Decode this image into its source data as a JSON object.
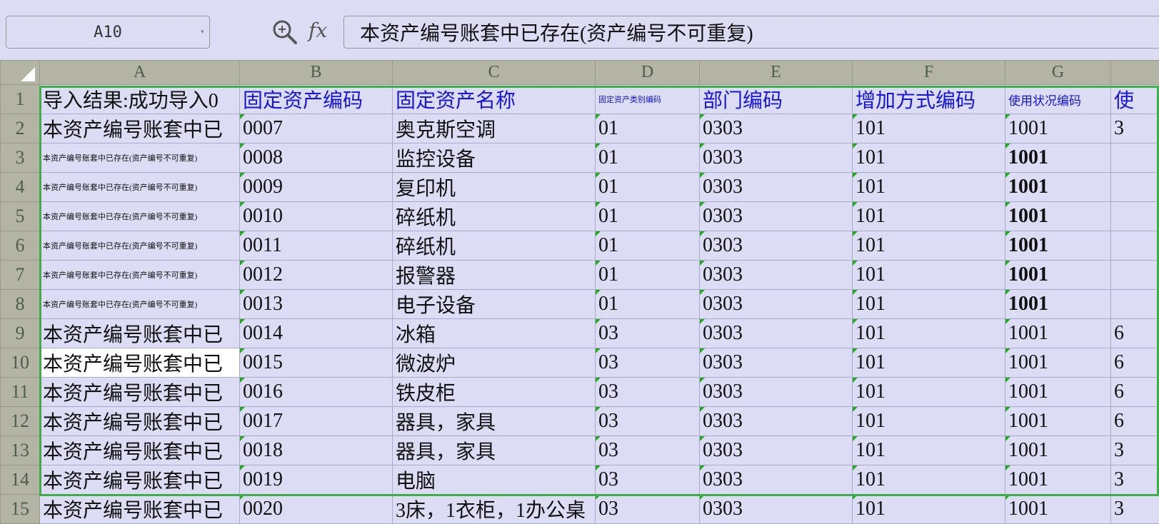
{
  "formula_bar": {
    "cell_ref": "A10",
    "fx_label": "fx",
    "formula": "本资产编号账套中已存在(资产编号不可重复)"
  },
  "columns": [
    "A",
    "B",
    "C",
    "D",
    "E",
    "F",
    "G"
  ],
  "header_row": {
    "row_num": "1",
    "a": "导入结果:成功导入0",
    "b": "固定资产编码",
    "c": "固定资产名称",
    "d": "固定资产类别编码",
    "e": "部门编码",
    "f": "增加方式编码",
    "g": "使用状况编码",
    "h": "使"
  },
  "rows": [
    {
      "n": "2",
      "a": "本资产编号账套中已",
      "b": "0007",
      "c": "奥克斯空调",
      "d": "01",
      "e": "0303",
      "f": "101",
      "g": "1001",
      "h": "3"
    },
    {
      "n": "3",
      "a": "本资产编号账套中已存在(资产编号不可重复)",
      "b": "0008",
      "c": "监控设备",
      "d": "01",
      "e": "0303",
      "f": "101",
      "g": "1001",
      "h": ""
    },
    {
      "n": "4",
      "a": "本资产编号账套中已存在(资产编号不可重复)",
      "b": "0009",
      "c": "复印机",
      "d": "01",
      "e": "0303",
      "f": "101",
      "g": "1001",
      "h": ""
    },
    {
      "n": "5",
      "a": "本资产编号账套中已存在(资产编号不可重复)",
      "b": "0010",
      "c": "碎纸机",
      "d": "01",
      "e": "0303",
      "f": "101",
      "g": "1001",
      "h": ""
    },
    {
      "n": "6",
      "a": "本资产编号账套中已存在(资产编号不可重复)",
      "b": "0011",
      "c": "碎纸机",
      "d": "01",
      "e": "0303",
      "f": "101",
      "g": "1001",
      "h": ""
    },
    {
      "n": "7",
      "a": "本资产编号账套中已存在(资产编号不可重复)",
      "b": "0012",
      "c": "报警器",
      "d": "01",
      "e": "0303",
      "f": "101",
      "g": "1001",
      "h": ""
    },
    {
      "n": "8",
      "a": "本资产编号账套中已存在(资产编号不可重复)",
      "b": "0013",
      "c": "电子设备",
      "d": "01",
      "e": "0303",
      "f": "101",
      "g": "1001",
      "h": ""
    },
    {
      "n": "9",
      "a": "本资产编号账套中已",
      "b": "0014",
      "c": "冰箱",
      "d": "03",
      "e": "0303",
      "f": "101",
      "g": "1001",
      "h": "6"
    },
    {
      "n": "10",
      "a": "本资产编号账套中已",
      "b": "0015",
      "c": "微波炉",
      "d": "03",
      "e": "0303",
      "f": "101",
      "g": "1001",
      "h": "6"
    },
    {
      "n": "11",
      "a": "本资产编号账套中已",
      "b": "0016",
      "c": "铁皮柜",
      "d": "03",
      "e": "0303",
      "f": "101",
      "g": "1001",
      "h": "6"
    },
    {
      "n": "12",
      "a": "本资产编号账套中已",
      "b": "0017",
      "c": "器具，家具",
      "d": "03",
      "e": "0303",
      "f": "101",
      "g": "1001",
      "h": "6"
    },
    {
      "n": "13",
      "a": "本资产编号账套中已",
      "b": "0018",
      "c": "器具，家具",
      "d": "03",
      "e": "0303",
      "f": "101",
      "g": "1001",
      "h": "3"
    },
    {
      "n": "14",
      "a": "本资产编号账套中已",
      "b": "0019",
      "c": "电脑",
      "d": "03",
      "e": "0303",
      "f": "101",
      "g": "1001",
      "h": "3"
    },
    {
      "n": "15",
      "a": "本资产编号账套中已",
      "b": "0020",
      "c": "3床，1衣柜，1办公桌",
      "d": "03",
      "e": "0303",
      "f": "101",
      "g": "1001",
      "h": "3"
    }
  ]
}
